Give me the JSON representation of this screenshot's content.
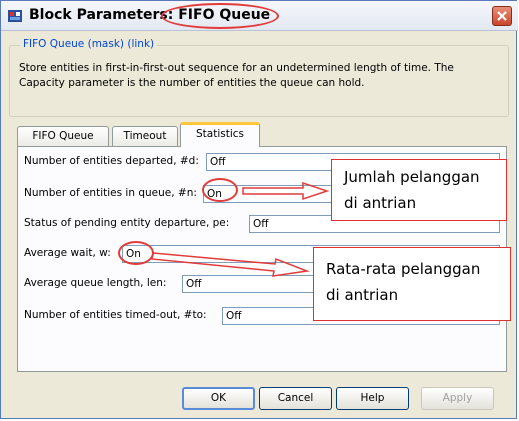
{
  "window": {
    "title": "Block Parameters: FIFO Queue",
    "title_icon": "simulink-block-icon",
    "close_icon": "close-icon"
  },
  "group": {
    "legend": "FIFO Queue (mask) (link)",
    "description": "Store entities in first-in-first-out sequence for an undetermined length of time. The Capacity parameter is the number of entities the queue can hold."
  },
  "tabs": [
    {
      "label": "FIFO Queue",
      "active": false
    },
    {
      "label": "Timeout",
      "active": false
    },
    {
      "label": "Statistics",
      "active": true
    }
  ],
  "params": [
    {
      "label": "Number of entities departed, #d:",
      "value": "Off"
    },
    {
      "label": "Number of entities in queue, #n:",
      "value": "On"
    },
    {
      "label": "Status of pending entity departure, pe:",
      "value": "Off"
    },
    {
      "label": "Average wait, w:",
      "value": "On"
    },
    {
      "label": "Average queue length, len:",
      "value": "Off"
    },
    {
      "label": "Number of entities timed-out, #to:",
      "value": "Off"
    }
  ],
  "annotations": [
    {
      "line1": "Jumlah pelanggan",
      "line2": "di antrian"
    },
    {
      "line1": "Rata-rata pelanggan",
      "line2": "di antrian"
    }
  ],
  "buttons": {
    "ok": "OK",
    "cancel": "Cancel",
    "help": "Help",
    "apply": "Apply"
  },
  "colors": {
    "annotation_red": "#e23b3b",
    "tab_highlight": "#ffc83c",
    "legend_blue": "#0046d5"
  }
}
